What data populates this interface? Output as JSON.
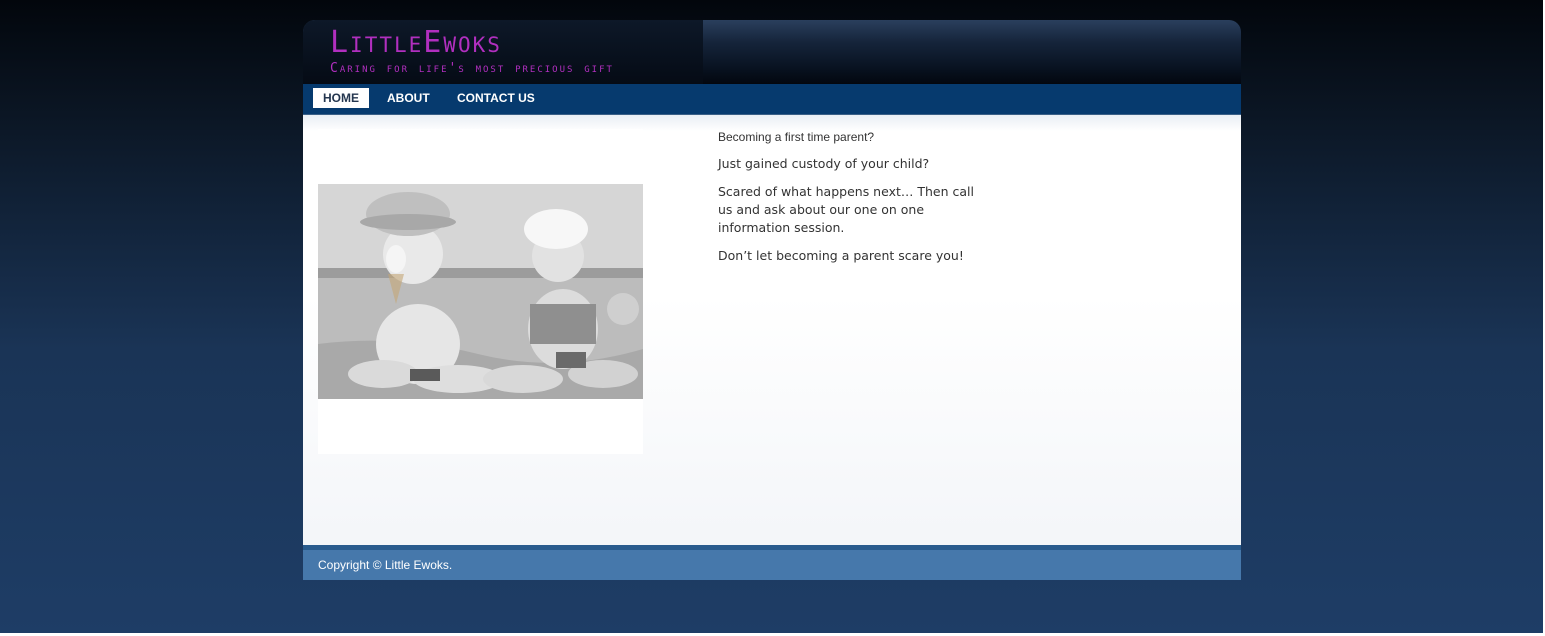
{
  "site": {
    "title": "LittleEwoks",
    "tagline": "Caring for life's most precious gift"
  },
  "nav": {
    "items": [
      {
        "label": "HOME",
        "active": true
      },
      {
        "label": "ABOUT",
        "active": false
      },
      {
        "label": "CONTACT US",
        "active": false
      }
    ]
  },
  "main": {
    "image": {
      "description_icon": "photo-two-toddlers-beach"
    },
    "paragraphs": [
      "Becoming a first time parent?",
      "Just gained custody of your child?",
      "Scared of what happens next… Then call us and ask about our one on one information session.",
      "Don’t let becoming a parent scare you!"
    ]
  },
  "footer": {
    "copyright": "Copyright © Little Ewoks."
  },
  "colors": {
    "brand_magenta": "#b12fbf",
    "nav_blue": "#063a6e",
    "footer_blue": "#4678ab"
  }
}
